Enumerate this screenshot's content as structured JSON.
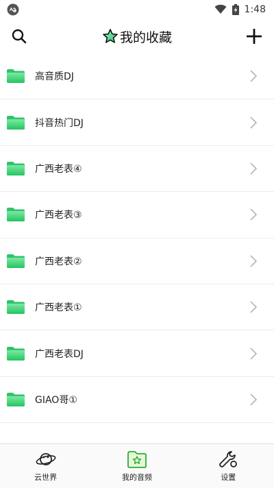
{
  "status_bar": {
    "time": "1:48"
  },
  "header": {
    "title": "我的收藏"
  },
  "list": {
    "items": [
      {
        "label": "高音质DJ"
      },
      {
        "label": "抖音热门DJ"
      },
      {
        "label": "广西老表④"
      },
      {
        "label": "广西老表③"
      },
      {
        "label": "广西老表②"
      },
      {
        "label": "广西老表①"
      },
      {
        "label": "广西老表DJ"
      },
      {
        "label": "GIAO哥①"
      }
    ]
  },
  "tabbar": {
    "tabs": [
      {
        "label": "云世界",
        "icon": "planet-icon"
      },
      {
        "label": "我的音频",
        "icon": "star-folder-icon",
        "active": true
      },
      {
        "label": "设置",
        "icon": "wrench-icon"
      }
    ]
  },
  "colors": {
    "accent": "#2ecc71",
    "folder": "#3ddc84"
  }
}
